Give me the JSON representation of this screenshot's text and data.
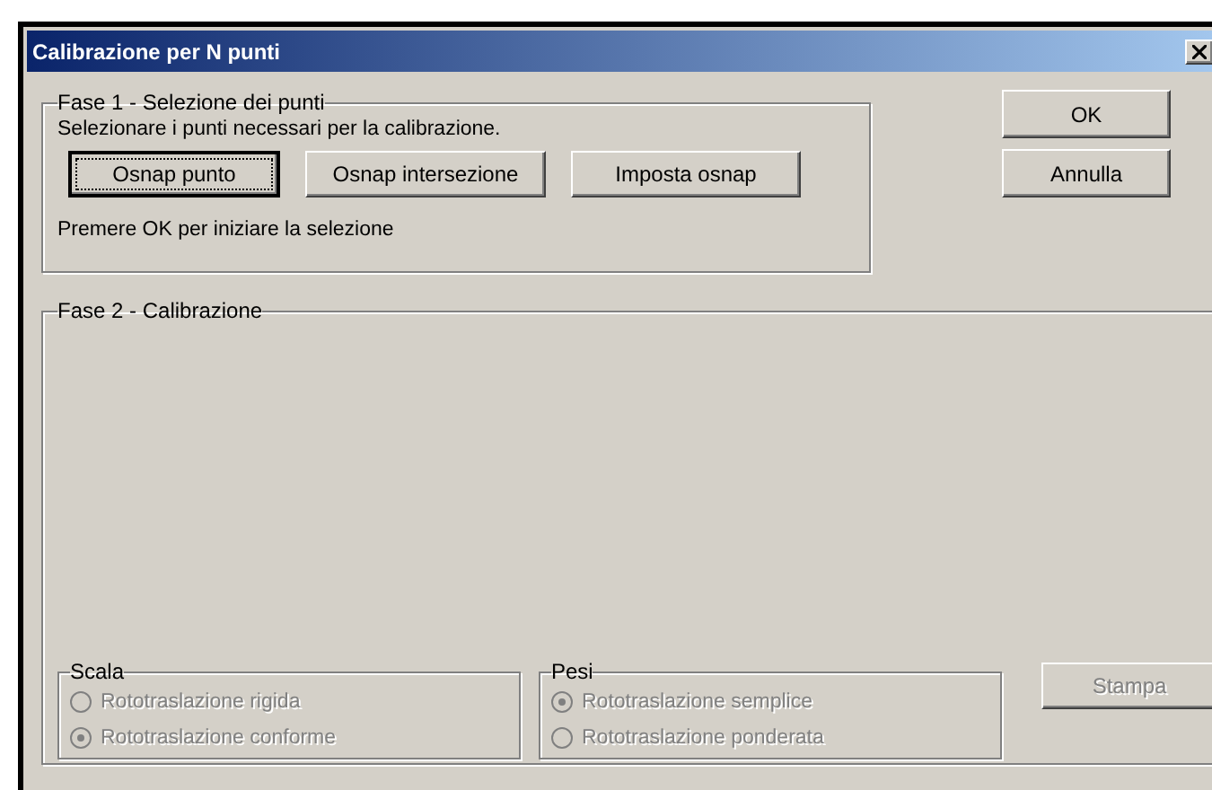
{
  "window": {
    "title": "Calibrazione per N punti"
  },
  "phase1": {
    "title": "Fase 1 - Selezione dei punti",
    "instruction": "Selezionare i punti necessari per la calibrazione.",
    "buttons": [
      {
        "label": "Osnap punto",
        "focused": true
      },
      {
        "label": "Osnap intersezione",
        "focused": false
      },
      {
        "label": "Imposta osnap",
        "focused": false
      }
    ],
    "hint": "Premere OK per iniziare la selezione"
  },
  "dialog_buttons": [
    {
      "label": "OK",
      "disabled": false
    },
    {
      "label": "Annulla",
      "disabled": false
    }
  ],
  "phase2": {
    "title": "Fase 2 - Calibrazione",
    "groups": [
      {
        "title": "Scala",
        "disabled": true,
        "options": [
          {
            "label": "Rototraslazione rigida",
            "selected": false
          },
          {
            "label": "Rototraslazione conforme",
            "selected": true
          }
        ]
      },
      {
        "title": "Pesi",
        "disabled": true,
        "options": [
          {
            "label": "Rototraslazione semplice",
            "selected": true
          },
          {
            "label": "Rototraslazione ponderata",
            "selected": false
          }
        ]
      }
    ],
    "print_button": {
      "label": "Stampa",
      "disabled": true
    }
  }
}
